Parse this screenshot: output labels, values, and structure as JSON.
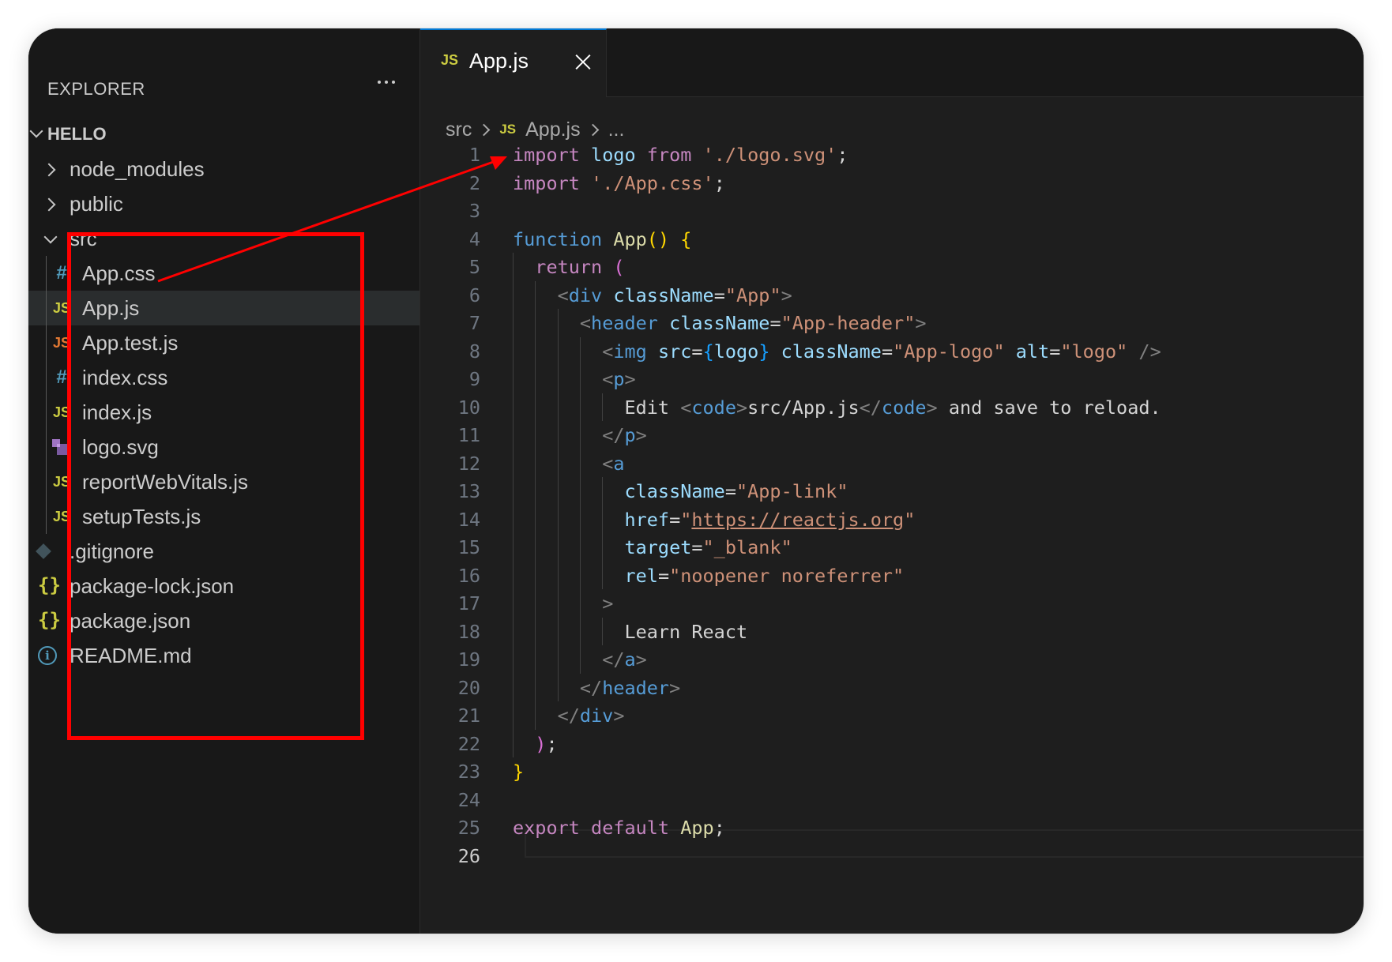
{
  "sidebar": {
    "title": "EXPLORER",
    "more_icon": "ellipsis-icon",
    "root": "HELLO",
    "items": [
      {
        "label": "node_modules",
        "type": "folder",
        "expanded": false
      },
      {
        "label": "public",
        "type": "folder",
        "expanded": false
      },
      {
        "label": "src",
        "type": "folder",
        "expanded": true
      },
      {
        "label": "App.css",
        "type": "css",
        "icon_text": "#"
      },
      {
        "label": "App.js",
        "type": "js",
        "icon_text": "JS",
        "selected": true
      },
      {
        "label": "App.test.js",
        "type": "jstest",
        "icon_text": "JS"
      },
      {
        "label": "index.css",
        "type": "css",
        "icon_text": "#"
      },
      {
        "label": "index.js",
        "type": "js",
        "icon_text": "JS"
      },
      {
        "label": "logo.svg",
        "type": "svg"
      },
      {
        "label": "reportWebVitals.js",
        "type": "js",
        "icon_text": "JS"
      },
      {
        "label": "setupTests.js",
        "type": "js",
        "icon_text": "JS"
      },
      {
        "label": ".gitignore",
        "type": "git"
      },
      {
        "label": "package-lock.json",
        "type": "json",
        "icon_text": "{}"
      },
      {
        "label": "package.json",
        "type": "json",
        "icon_text": "{}"
      },
      {
        "label": "README.md",
        "type": "info",
        "icon_text": "i"
      }
    ]
  },
  "tab": {
    "icon_text": "JS",
    "label": "App.js",
    "close_icon": "close-icon"
  },
  "breadcrumb": {
    "items": [
      "src",
      "App.js",
      "..."
    ],
    "file_icon_text": "JS"
  },
  "editor": {
    "active_line": 26,
    "lines": [
      [
        [
          "kw",
          "import"
        ],
        [
          "tx",
          " "
        ],
        [
          "lb",
          "logo"
        ],
        [
          "tx",
          " "
        ],
        [
          "kw",
          "from"
        ],
        [
          "tx",
          " "
        ],
        [
          "st",
          "'./logo.svg'"
        ],
        [
          "tx",
          ";"
        ]
      ],
      [
        [
          "kw",
          "import"
        ],
        [
          "tx",
          " "
        ],
        [
          "st",
          "'./App.css'"
        ],
        [
          "tx",
          ";"
        ]
      ],
      [],
      [
        [
          "bl",
          "function"
        ],
        [
          "tx",
          " "
        ],
        [
          "fn",
          "App"
        ],
        [
          "br1",
          "()"
        ],
        [
          "tx",
          " "
        ],
        [
          "br1",
          "{"
        ]
      ],
      [
        [
          "tx",
          "  "
        ],
        [
          "kw",
          "return"
        ],
        [
          "tx",
          " "
        ],
        [
          "br2",
          "("
        ]
      ],
      [
        [
          "tx",
          "    "
        ],
        [
          "gy",
          "<"
        ],
        [
          "bl",
          "div"
        ],
        [
          "tx",
          " "
        ],
        [
          "lb",
          "className"
        ],
        [
          "tx",
          "="
        ],
        [
          "st",
          "\"App\""
        ],
        [
          "gy",
          ">"
        ]
      ],
      [
        [
          "tx",
          "      "
        ],
        [
          "gy",
          "<"
        ],
        [
          "bl",
          "header"
        ],
        [
          "tx",
          " "
        ],
        [
          "lb",
          "className"
        ],
        [
          "tx",
          "="
        ],
        [
          "st",
          "\"App-header\""
        ],
        [
          "gy",
          ">"
        ]
      ],
      [
        [
          "tx",
          "        "
        ],
        [
          "gy",
          "<"
        ],
        [
          "bl",
          "img"
        ],
        [
          "tx",
          " "
        ],
        [
          "lb",
          "src"
        ],
        [
          "tx",
          "="
        ],
        [
          "br3",
          "{"
        ],
        [
          "lb",
          "logo"
        ],
        [
          "br3",
          "}"
        ],
        [
          "tx",
          " "
        ],
        [
          "lb",
          "className"
        ],
        [
          "tx",
          "="
        ],
        [
          "st",
          "\"App-logo\""
        ],
        [
          "tx",
          " "
        ],
        [
          "lb",
          "alt"
        ],
        [
          "tx",
          "="
        ],
        [
          "st",
          "\"logo\""
        ],
        [
          "tx",
          " "
        ],
        [
          "gy",
          "/>"
        ]
      ],
      [
        [
          "tx",
          "        "
        ],
        [
          "gy",
          "<"
        ],
        [
          "bl",
          "p"
        ],
        [
          "gy",
          ">"
        ]
      ],
      [
        [
          "tx",
          "          Edit "
        ],
        [
          "gy",
          "<"
        ],
        [
          "bl",
          "code"
        ],
        [
          "gy",
          ">"
        ],
        [
          "tx",
          "src/App.js"
        ],
        [
          "gy",
          "</"
        ],
        [
          "bl",
          "code"
        ],
        [
          "gy",
          ">"
        ],
        [
          "tx",
          " and save to reload."
        ]
      ],
      [
        [
          "tx",
          "        "
        ],
        [
          "gy",
          "</"
        ],
        [
          "bl",
          "p"
        ],
        [
          "gy",
          ">"
        ]
      ],
      [
        [
          "tx",
          "        "
        ],
        [
          "gy",
          "<"
        ],
        [
          "bl",
          "a"
        ]
      ],
      [
        [
          "tx",
          "          "
        ],
        [
          "lb",
          "className"
        ],
        [
          "tx",
          "="
        ],
        [
          "st",
          "\"App-link\""
        ]
      ],
      [
        [
          "tx",
          "          "
        ],
        [
          "lb",
          "href"
        ],
        [
          "tx",
          "="
        ],
        [
          "st",
          "\""
        ],
        [
          "st ul",
          "https://reactjs.org"
        ],
        [
          "st",
          "\""
        ]
      ],
      [
        [
          "tx",
          "          "
        ],
        [
          "lb",
          "target"
        ],
        [
          "tx",
          "="
        ],
        [
          "st",
          "\"_blank\""
        ]
      ],
      [
        [
          "tx",
          "          "
        ],
        [
          "lb",
          "rel"
        ],
        [
          "tx",
          "="
        ],
        [
          "st",
          "\"noopener noreferrer\""
        ]
      ],
      [
        [
          "tx",
          "        "
        ],
        [
          "gy",
          ">"
        ]
      ],
      [
        [
          "tx",
          "          Learn React"
        ]
      ],
      [
        [
          "tx",
          "        "
        ],
        [
          "gy",
          "</"
        ],
        [
          "bl",
          "a"
        ],
        [
          "gy",
          ">"
        ]
      ],
      [
        [
          "tx",
          "      "
        ],
        [
          "gy",
          "</"
        ],
        [
          "bl",
          "header"
        ],
        [
          "gy",
          ">"
        ]
      ],
      [
        [
          "tx",
          "    "
        ],
        [
          "gy",
          "</"
        ],
        [
          "bl",
          "div"
        ],
        [
          "gy",
          ">"
        ]
      ],
      [
        [
          "tx",
          "  "
        ],
        [
          "br2",
          ")"
        ],
        [
          "tx",
          ";"
        ]
      ],
      [
        [
          "br1",
          "}"
        ]
      ],
      [],
      [
        [
          "kw",
          "export"
        ],
        [
          "tx",
          " "
        ],
        [
          "kw",
          "default"
        ],
        [
          "tx",
          " "
        ],
        [
          "fn",
          "App"
        ],
        [
          "tx",
          ";"
        ]
      ],
      []
    ]
  },
  "colors": {
    "accent": "#0078d4",
    "annotation": "#ff0000",
    "js_icon": "#cbcb41",
    "css_icon": "#519aba"
  }
}
